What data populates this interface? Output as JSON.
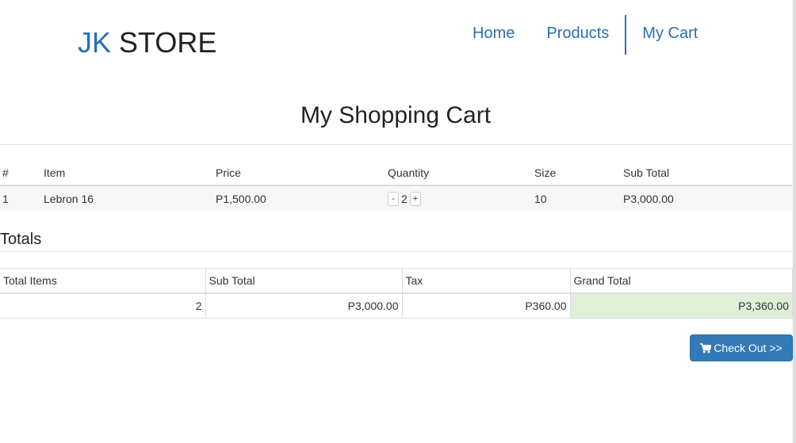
{
  "brand": {
    "part1": "JK",
    "part2": "STORE"
  },
  "nav": {
    "items": [
      "Home",
      "Products",
      "My Cart"
    ],
    "active": "My Cart"
  },
  "page_title": "My Shopping Cart",
  "cart": {
    "headers": [
      "#",
      "Item",
      "Price",
      "Quantity",
      "Size",
      "Sub Total"
    ],
    "rows": [
      {
        "num": "1",
        "item": "Lebron 16",
        "price": "P1,500.00",
        "qty_minus": "-",
        "qty": "2",
        "qty_plus": "+",
        "size": "10",
        "subtotal": "P3,000.00"
      }
    ]
  },
  "totals": {
    "heading": "Totals",
    "headers": [
      "Total Items",
      "Sub Total",
      "Tax",
      "Grand Total"
    ],
    "values": [
      "2",
      "P3,000.00",
      "P360.00",
      "P3,360.00"
    ]
  },
  "checkout": {
    "label": "Check Out >>",
    "icon": "shopping-cart-icon"
  },
  "colors": {
    "brand_accent": "#2a6fb0",
    "button_primary": "#337ab7",
    "grand_total_bg": "#dff0d8"
  }
}
